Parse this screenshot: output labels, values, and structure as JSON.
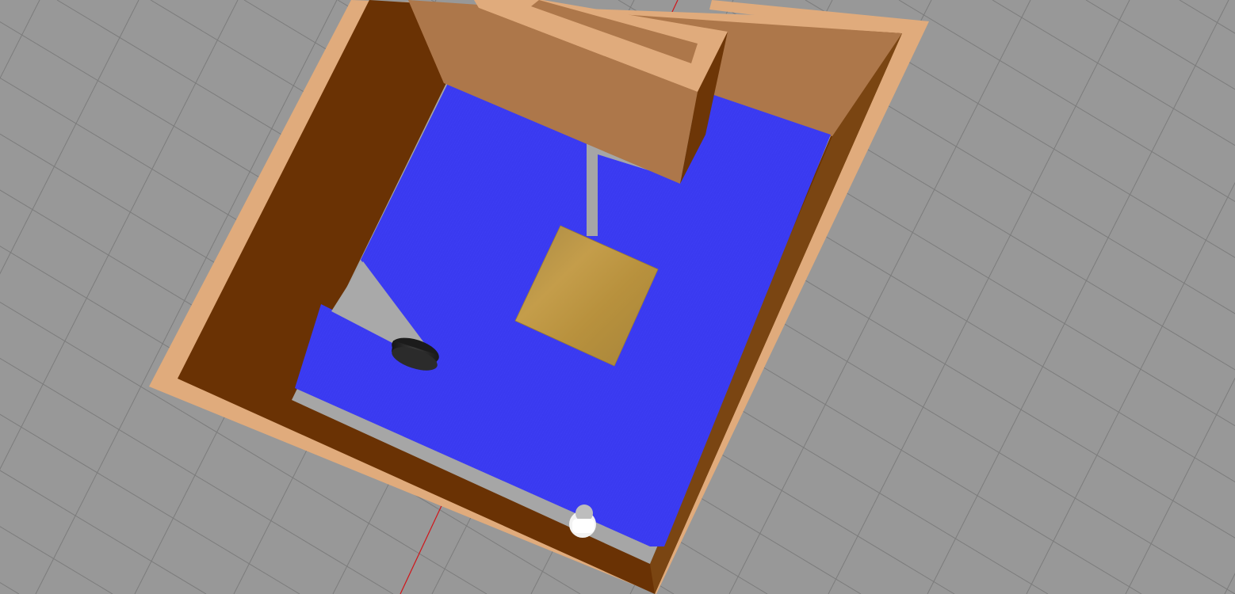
{
  "scene": {
    "type": "3d-simulation-viewport",
    "view": "top-down-perspective",
    "colors": {
      "ground": "#989898",
      "grid_line": "#7a7a7a",
      "axis_x": "#d0161a",
      "wall_top": "#e0ab7c",
      "wall_side_dark": "#6a3204",
      "wall_side_mid": "#7a4512",
      "wall_face_light": "#ad774a",
      "floor": "#a6a6a6",
      "laser_scan": "#0a0aff",
      "box_top": "#b8923e",
      "robot_body": "#222222",
      "sensor": "#f2f2f2"
    },
    "objects": [
      {
        "name": "outer-wall-frame",
        "icon": "wall-frame-icon"
      },
      {
        "name": "inner-divider-wall",
        "icon": "wall-icon"
      },
      {
        "name": "laser-scan-area",
        "icon": "laser-scan-icon"
      },
      {
        "name": "wooden-box",
        "icon": "box-icon"
      },
      {
        "name": "mobile-robot",
        "icon": "robot-icon"
      },
      {
        "name": "lidar-sensor",
        "icon": "lidar-icon"
      }
    ]
  }
}
